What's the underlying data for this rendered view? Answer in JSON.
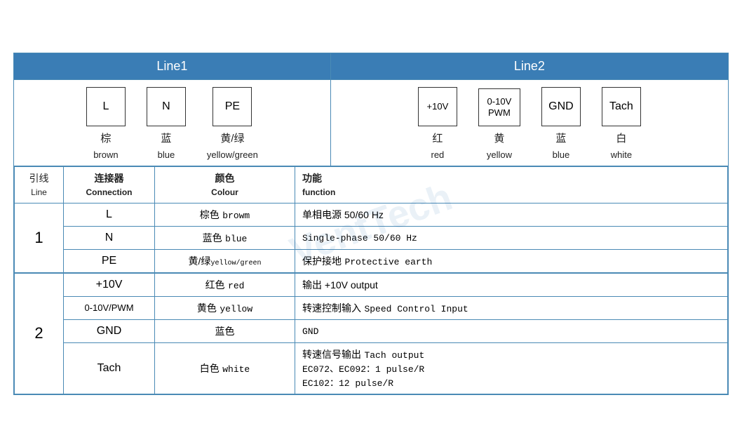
{
  "headers": {
    "line1": "Line1",
    "line2": "Line2"
  },
  "line1_connectors": [
    {
      "id": "L",
      "label_cn": "棕",
      "label_en": "brown"
    },
    {
      "id": "N",
      "label_cn": "蓝",
      "label_en": "blue"
    },
    {
      "id": "PE",
      "label_cn": "黄/绿",
      "label_en": "yellow/green"
    }
  ],
  "line2_connectors": [
    {
      "id": "+10V",
      "label_cn": "红",
      "label_en": "red"
    },
    {
      "id": "0-10V\nPWM",
      "label_cn": "黄",
      "label_en": "yellow"
    },
    {
      "id": "GND",
      "label_cn": "蓝",
      "label_en": "blue"
    },
    {
      "id": "Tach",
      "label_cn": "白",
      "label_en": "white"
    }
  ],
  "table_headers": {
    "line_cn": "引线",
    "line_en": "Line",
    "connection_cn": "连接器",
    "connection_en": "Connection",
    "colour_cn": "颜色",
    "colour_en": "Colour",
    "function_cn": "功能",
    "function_en": "function"
  },
  "rows": [
    {
      "line_number": "1",
      "entries": [
        {
          "connection": "L",
          "colour_cn": "棕色",
          "colour_en": "browm",
          "function": "单相电源 50/60 Hz"
        },
        {
          "connection": "N",
          "colour_cn": "蓝色",
          "colour_en": "blue",
          "function": "Single-phase 50/60 Hz"
        },
        {
          "connection": "PE",
          "colour_cn": "黄/绿",
          "colour_en_small": "yellow/green",
          "function": "保护接地 Protective earth"
        }
      ]
    },
    {
      "line_number": "2",
      "entries": [
        {
          "connection": "+10V",
          "colour_cn": "红色",
          "colour_en": "red",
          "function": "输出 +10V output"
        },
        {
          "connection": "0-10V/PWM",
          "colour_cn": "黄色",
          "colour_en": "yellow",
          "function": "转速控制输入 Speed Control Input"
        },
        {
          "connection": "GND",
          "colour_cn": "蓝色",
          "colour_en": "",
          "function": "GND"
        },
        {
          "connection": "Tach",
          "colour_cn": "白色",
          "colour_en": "white",
          "function_lines": [
            "转速信号输出 Tach output",
            "EC072、EC092：1 pulse/R",
            "EC102：12 pulse/R"
          ]
        }
      ]
    }
  ]
}
